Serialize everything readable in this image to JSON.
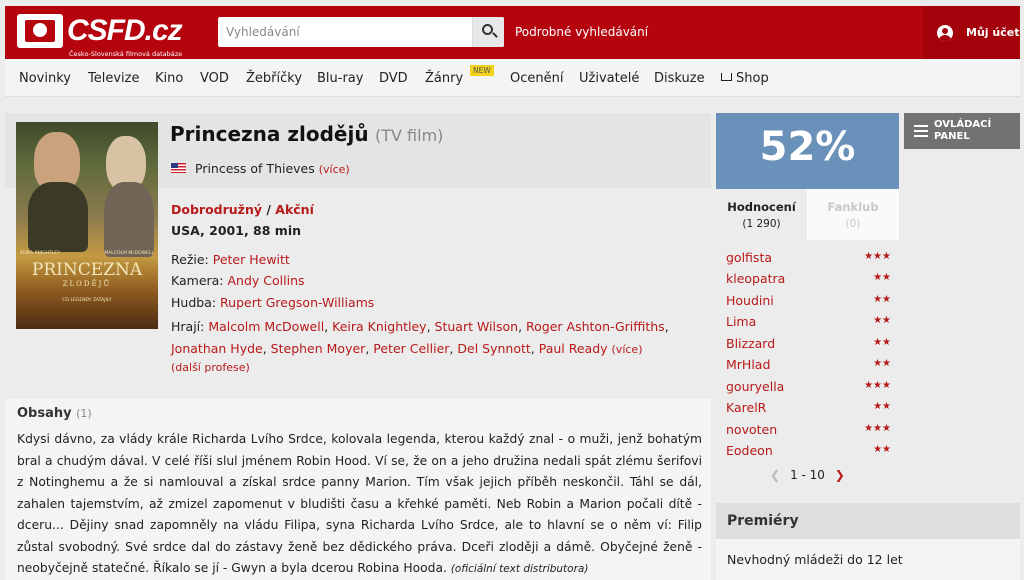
{
  "header": {
    "logo_text": "CSFD.cz",
    "logo_subtitle": "Česko-Slovenská filmová databáze",
    "search_placeholder": "Vyhledávání",
    "advanced_search": "Podrobné vyhledávání",
    "account": "Můj účet",
    "accent_color": "#b5040e"
  },
  "nav": {
    "items": [
      "Novinky",
      "Televize",
      "Kino",
      "VOD",
      "Žebříčky",
      "Blu-ray",
      "DVD",
      "Žánry",
      "Ocenění",
      "Uživatelé",
      "Diskuze",
      "Shop"
    ],
    "new_badge": "NEW"
  },
  "film": {
    "title": "Princezna zlodějů",
    "type": "(TV film)",
    "original_title": "Princess of Thieves",
    "original_more": "(více)",
    "genre_1": "Dobrodružný",
    "genre_sep": " / ",
    "genre_2": "Akční",
    "origin": "USA, 2001, 88 min",
    "director_label": "Režie:",
    "director": "Peter Hewitt",
    "camera_label": "Kamera:",
    "camera": "Andy Collins",
    "music_label": "Hudba:",
    "music": "Rupert Gregson-Williams",
    "cast_label": "Hrají:",
    "cast": [
      "Malcolm McDowell",
      "Keira Knightley",
      "Stuart Wilson",
      "Roger Ashton-Griffiths",
      "Jonathan Hyde",
      "Stephen Moyer",
      "Peter Cellier",
      "Del Synnott",
      "Paul Ready"
    ],
    "cast_more": "(více)",
    "other_professions": "(další profese)",
    "poster": {
      "title": "PRINCEZNA",
      "subtitle": "ZLODĚJŮ",
      "actor_1": "KEIRA KNIGHTLEY",
      "actor_2": "MALCOLM McDOWELL",
      "tagline": "CO LEGENDY ZATAJILY"
    }
  },
  "plot": {
    "heading": "Obsahy",
    "count": "(1)",
    "text": "Kdysi dávno, za vlády krále Richarda Lvího Srdce, kolovala legenda, kterou každý znal - o muži, jenž bohatým bral a chudým dával. V celé říši slul jménem Robin Hood. Ví se, že on a jeho družina nedali spát zlému šerifovi z Notinghemu a že si namlouval a získal srdce panny Marion. Tím však jejich příběh neskončil. Táhl se dál, zahalen tajemstvím, až zmizel zapomenut v bludišti času a křehké paměti. Neb Robin a Marion počali dítě - dceru... Dějiny snad zapomněly na vládu Filipa, syna Richarda Lvího Srdce, ale to hlavní se o něm ví: Filip zůstal svobodný. Své srdce dal do zástavy ženě bez dědického práva. Dceři zloději a dámě. Obyčejné ženě - neobyčejně statečné. Říkalo se jí - Gwyn a byla dcerou Robina Hooda.",
    "source": "(oficiální text distributora)"
  },
  "rating": {
    "value": "52%",
    "box_color": "#6a91b9",
    "tab_ratings": "Hodnocení",
    "tab_ratings_count": "(1 290)",
    "tab_fanclub": "Fanklub",
    "tab_fanclub_count": "(0)",
    "users": [
      {
        "name": "golfista",
        "stars": "★★★"
      },
      {
        "name": "kleopatra",
        "stars": "★★"
      },
      {
        "name": "Houdini",
        "stars": "★★"
      },
      {
        "name": "Lima",
        "stars": "★★"
      },
      {
        "name": "Blizzard",
        "stars": "★★"
      },
      {
        "name": "MrHlad",
        "stars": "★★"
      },
      {
        "name": "gouryella",
        "stars": "★★★"
      },
      {
        "name": "KarelR",
        "stars": "★★"
      },
      {
        "name": "novoten",
        "stars": "★★★"
      },
      {
        "name": "Eodeon",
        "stars": "★★"
      }
    ],
    "pager": "1 - 10"
  },
  "control_panel": {
    "label": "OVLÁDACÍ PANEL"
  },
  "premieres": {
    "heading": "Premiéry",
    "text": "Nevhodný mládeži do 12 let"
  }
}
